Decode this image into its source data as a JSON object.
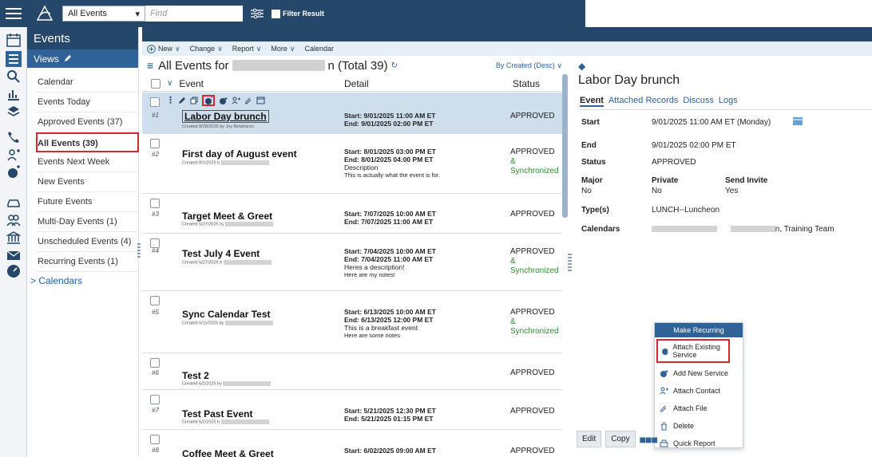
{
  "topbar": {
    "select_value": "All Events",
    "search_placeholder": "Find",
    "filter_label": "Filter Result"
  },
  "nav": {
    "section": "Events",
    "views_label": "Views",
    "items": [
      {
        "label": "Calendar"
      },
      {
        "label": "Events Today"
      },
      {
        "label": "Approved Events (37)"
      },
      {
        "label": "All Events (39)"
      },
      {
        "label": "Events Next Week"
      },
      {
        "label": "New Events"
      },
      {
        "label": "Future Events"
      },
      {
        "label": "Multi-Day Events (1)"
      },
      {
        "label": "Unscheduled Events (4)"
      },
      {
        "label": "Recurring Events (1)"
      }
    ],
    "calendars_link": "> Calendars"
  },
  "toolbar": {
    "new": "New",
    "change": "Change",
    "report": "Report",
    "more": "More",
    "calendar": "Calendar"
  },
  "list": {
    "title_prefix": "All Events for",
    "title_suffix": "n (Total 39)",
    "sort": "By Created (Desc)",
    "col_event": "Event",
    "col_detail": "Detail",
    "col_status": "Status",
    "rows": [
      {
        "num": "#1",
        "title": "Labor Day brunch",
        "created": "Created 8/28/2025 by Joy Betaharon",
        "start": "Start: 9/01/2025 11:00 AM ET",
        "end": "End: 9/01/2025 02:00 PM ET",
        "desc": "",
        "note": "",
        "status": "APPROVED",
        "sync": ""
      },
      {
        "num": "#2",
        "title": "First day of August event",
        "created": "Created 8/1/2025 b",
        "start": "Start: 8/01/2025 03:00 PM ET",
        "end": "End: 8/01/2025 04:00 PM ET",
        "desc": "Description",
        "note": "This is actually what the event is for.",
        "status": "APPROVED",
        "amp": "&",
        "sync": "Synchronized"
      },
      {
        "num": "#3",
        "title": "Target Meet & Greet",
        "created": "Created 6/27/2025 by",
        "start": "Start: 7/07/2025 10:00 AM ET",
        "end": "End: 7/07/2025 11:00 AM ET",
        "desc": "",
        "note": "",
        "status": "APPROVED",
        "sync": ""
      },
      {
        "num": "#4",
        "title": "Test July 4 Event",
        "created": "Created 6/27/2025 b",
        "start": "Start: 7/04/2025 10:00 AM ET",
        "end": "End: 7/04/2025 11:00 AM ET",
        "desc": "Heres a description!",
        "note": "Here are my notes!",
        "status": "APPROVED",
        "amp": "&",
        "sync": "Synchronized"
      },
      {
        "num": "#5",
        "title": "Sync Calendar Test",
        "created": "Created 6/11/2025 by",
        "start": "Start: 6/13/2025 10:00 AM ET",
        "end": "End: 6/13/2025 12:00 PM ET",
        "desc": "This is a breakfast event",
        "note": "Here are some notes",
        "status": "APPROVED",
        "amp": "&",
        "sync": "Synchronized"
      },
      {
        "num": "#6",
        "title": "Test 2",
        "created": "Created 6/2/2025 by",
        "start": "",
        "end": "",
        "desc": "",
        "note": "",
        "status": "APPROVED",
        "sync": ""
      },
      {
        "num": "#7",
        "title": "Test Past Event",
        "created": "Created 6/2/2025 b",
        "start": "Start: 5/21/2025 12:30 PM ET",
        "end": "End: 5/21/2025 01:15 PM ET",
        "desc": "",
        "note": "",
        "status": "APPROVED",
        "sync": ""
      },
      {
        "num": "#8",
        "title": "Coffee Meet & Greet",
        "created": "",
        "start": "Start: 6/02/2025 09:00 AM ET",
        "end": "",
        "desc": "",
        "note": "",
        "status": "APPROVED",
        "sync": ""
      }
    ]
  },
  "detail": {
    "title": "Labor Day brunch",
    "tabs": [
      "Event",
      "Attached Records",
      "Discuss",
      "Logs"
    ],
    "start_label": "Start",
    "start_value": "9/01/2025 11:00 AM ET (Monday)",
    "end_label": "End",
    "end_value": "9/01/2025 02:00 PM ET",
    "status_label": "Status",
    "status_value": "APPROVED",
    "major_label": "Major",
    "major_value": "No",
    "private_label": "Private",
    "private_value": "No",
    "invite_label": "Send Invite",
    "invite_value": "Yes",
    "types_label": "Type(s)",
    "types_value": "LUNCH--Luncheon",
    "calendars_label": "Calendars",
    "calendars_value": "n, Training Team",
    "edit": "Edit",
    "copy": "Copy"
  },
  "popup": {
    "header": "Make Recurring",
    "items": [
      "Attach Existing Service",
      "Add New Service",
      "Attach Contact",
      "Attach File",
      "Delete",
      "Quick Report"
    ]
  }
}
